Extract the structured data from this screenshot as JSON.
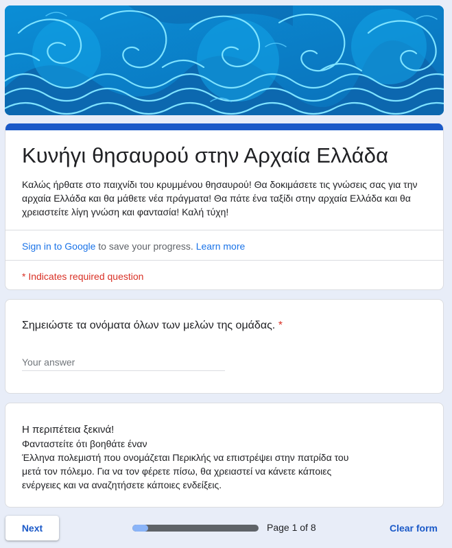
{
  "banner": {
    "description_icon": "waves-pattern"
  },
  "form": {
    "title": "Κυνήγι θησαυρού στην Αρχαία Ελλάδα",
    "description": "Καλώς ήρθατε στο παιχνίδι του κρυμμένου θησαυρού! Θα δοκιμάσετε τις γνώσεις σας για την αρχαία Ελλάδα και θα μάθετε νέα πράγματα! Θα πάτε ένα ταξίδι στην αρχαία Ελλάδα και θα χρειαστείτε λίγη γνώση και φαντασία! Καλή τύχη!",
    "signin_link": "Sign in to Google",
    "signin_middle": " to save your progress. ",
    "learn_more": "Learn more",
    "required_note": "* Indicates required question",
    "accent_color": "#1a59c8"
  },
  "question": {
    "text": "Σημειώστε τα ονόματα όλων των μελών της ομάδας.",
    "required_mark": "*",
    "placeholder": "Your answer",
    "value": ""
  },
  "info": {
    "heading": "Η περιπέτεια ξεκινά!",
    "line1": "Φανταστείτε ότι βοηθάτε έναν",
    "line2": "Έλληνα πολεμιστή που ονομάζεται Περικλής να επιστρέψει στην πατρίδα του",
    "line3": "μετά τον πόλεμο. Για να τον φέρετε πίσω, θα χρειαστεί να κάνετε κάποιες",
    "line4": "ενέργειες και να αναζητήσετε κάποιες ενδείξεις."
  },
  "footer": {
    "next_label": "Next",
    "page_text": "Page 1 of 8",
    "progress_fraction": 0.125,
    "clear_label": "Clear form"
  }
}
